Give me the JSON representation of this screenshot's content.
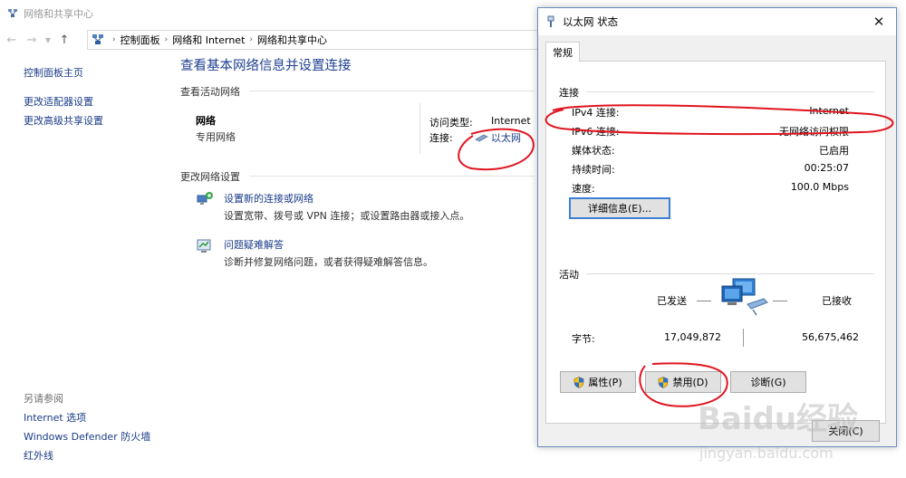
{
  "background_window": {
    "title": "网络和共享中心",
    "breadcrumbs": [
      "控制面板",
      "网络和 Internet",
      "网络和共享中心"
    ],
    "left_pane": {
      "home": "控制面板主页",
      "adapter_settings": "更改适配器设置",
      "advanced_sharing": "更改高级共享设置",
      "see_also": "另请参阅",
      "see_also_items": [
        "Internet 选项",
        "Windows Defender 防火墙",
        "红外线"
      ]
    },
    "main": {
      "title": "查看基本网络信息并设置连接",
      "active_networks_label": "查看活动网络",
      "network_name": "网络",
      "network_type": "专用网络",
      "access_type_label": "访问类型:",
      "access_type_value": "Internet",
      "connection_label": "连接:",
      "connection_value": "以太网",
      "change_settings_label": "更改网络设置",
      "task1_link": "设置新的连接或网络",
      "task1_desc": "设置宽带、拨号或 VPN 连接；或设置路由器或接入点。",
      "task2_link": "问题疑难解答",
      "task2_desc": "诊断并修复网络问题，或者获得疑难解答信息。"
    }
  },
  "dialog": {
    "title": "以太网 状态",
    "close_glyph": "✕",
    "tab": "常规",
    "connection_group": "连接",
    "rows": [
      {
        "key": "IPv4 连接:",
        "value": "Internet"
      },
      {
        "key": "IPv6 连接:",
        "value": "无网络访问权限"
      },
      {
        "key": "媒体状态:",
        "value": "已启用"
      },
      {
        "key": "持续时间:",
        "value": "00:25:07"
      },
      {
        "key": "速度:",
        "value": "100.0 Mbps"
      }
    ],
    "details_button": "详细信息(E)...",
    "activity_group": "活动",
    "sent_label": "已发送",
    "received_label": "已接收",
    "bytes_label": "字节:",
    "bytes_sent": "17,049,872",
    "bytes_received": "56,675,462",
    "properties_button": "属性(P)",
    "disable_button": "禁用(D)",
    "diagnose_button": "诊断(G)",
    "close_button": "关闭(C)"
  },
  "watermark": {
    "brand": "Baidu经验",
    "url": "jingyan.baidu.com"
  },
  "colors": {
    "link": "#1a3c88",
    "title": "#1e3f91",
    "annotation": "#e0141e",
    "dialog_border": "#6b8bbf",
    "dialog_bg": "#f0f0f0"
  }
}
